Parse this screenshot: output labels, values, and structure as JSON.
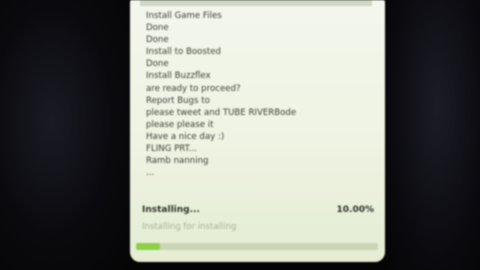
{
  "log": {
    "lines": [
      "Install Game Files",
      "Done",
      "Done",
      "Install to Boosted",
      "Done",
      "Install Buzzflex",
      "are ready to proceed?",
      "Report Bugs to",
      "please tweet and TUBE RIVERBode",
      "please please it",
      "Have a nice day :)",
      "FLING PRT...",
      "Ramb nanning",
      "..."
    ]
  },
  "status": {
    "label": "Installing...",
    "percent_text": "10.00%",
    "sub_label": "Installing for installing"
  },
  "progress": {
    "value": 0.1
  },
  "colors": {
    "screen_bg": "#f0f4e6",
    "progress_fill": "#8fd04a",
    "text": "#3c3f35"
  }
}
